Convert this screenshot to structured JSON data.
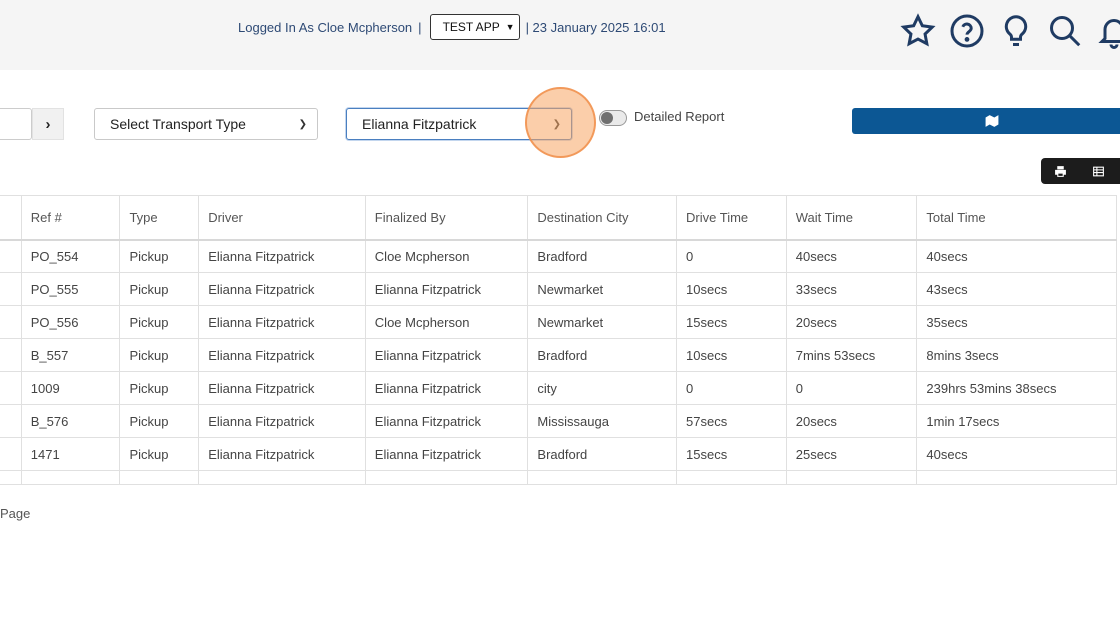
{
  "header": {
    "logged_in_text": "Logged In As Cloe Mcpherson",
    "separator": "|",
    "app_select_value": "TEST APP",
    "datetime_text": "| 23 January 2025 16:01",
    "icons": [
      "star-icon",
      "help-circle-icon",
      "lightbulb-icon",
      "search-icon",
      "bell-icon"
    ]
  },
  "filters": {
    "next_label": "›",
    "transport_type_value": "Select Transport Type",
    "driver_value": "Elianna Fitzpatrick",
    "detailed_report_label": "Detailed Report",
    "detailed_report_on": false
  },
  "toolbar": {
    "map_icon": "map-icon",
    "print_icon": "print-icon",
    "table_icon": "table-icon"
  },
  "table": {
    "columns": [
      "Ref #",
      "Type",
      "Driver",
      "Finalized By",
      "Destination City",
      "Drive Time",
      "Wait Time",
      "Total Time"
    ],
    "rows": [
      [
        "PO_554",
        "Pickup",
        "Elianna Fitzpatrick",
        "Cloe Mcpherson",
        "Bradford",
        "0",
        "40secs",
        "40secs"
      ],
      [
        "PO_555",
        "Pickup",
        "Elianna Fitzpatrick",
        "Elianna Fitzpatrick",
        "Newmarket",
        "10secs",
        "33secs",
        "43secs"
      ],
      [
        "PO_556",
        "Pickup",
        "Elianna Fitzpatrick",
        "Cloe Mcpherson",
        "Newmarket",
        "15secs",
        "20secs",
        "35secs"
      ],
      [
        "B_557",
        "Pickup",
        "Elianna Fitzpatrick",
        "Elianna Fitzpatrick",
        "Bradford",
        "10secs",
        "7mins 53secs",
        "8mins 3secs"
      ],
      [
        "1009",
        "Pickup",
        "Elianna Fitzpatrick",
        "Elianna Fitzpatrick",
        "city",
        "0",
        "0",
        "239hrs 53mins 38secs"
      ],
      [
        "B_576",
        "Pickup",
        "Elianna Fitzpatrick",
        "Elianna Fitzpatrick",
        "Mississauga",
        "57secs",
        "20secs",
        "1min 17secs"
      ],
      [
        "1471",
        "Pickup",
        "Elianna Fitzpatrick",
        "Elianna Fitzpatrick",
        "Bradford",
        "15secs",
        "25secs",
        "40secs"
      ]
    ]
  },
  "footer": {
    "page_label": "Page"
  }
}
